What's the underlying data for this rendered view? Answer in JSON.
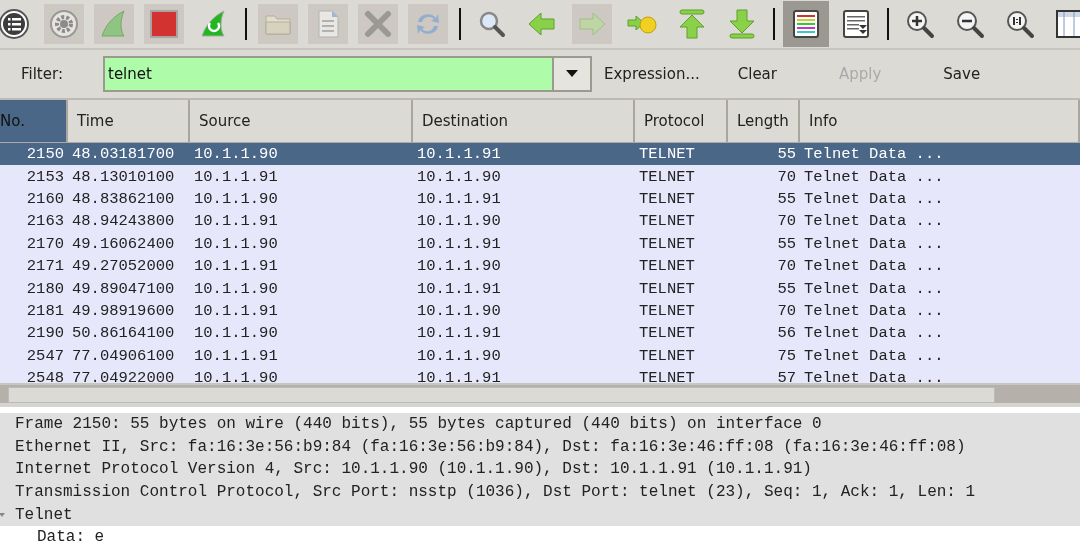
{
  "toolbar": [
    {
      "kind": "interfaces",
      "disabled": false
    },
    {
      "kind": "options",
      "disabled": true
    },
    {
      "kind": "start",
      "disabled": true
    },
    {
      "kind": "stop",
      "disabled": true
    },
    {
      "kind": "restart",
      "disabled": false
    },
    {
      "kind": "separator"
    },
    {
      "kind": "open",
      "disabled": true
    },
    {
      "kind": "file",
      "disabled": true
    },
    {
      "kind": "close",
      "disabled": true
    },
    {
      "kind": "reload",
      "disabled": true
    },
    {
      "kind": "separator"
    },
    {
      "kind": "find",
      "disabled": false
    },
    {
      "kind": "back",
      "disabled": false
    },
    {
      "kind": "forward",
      "disabled": true
    },
    {
      "kind": "goto",
      "disabled": false
    },
    {
      "kind": "first",
      "disabled": false
    },
    {
      "kind": "last",
      "disabled": false
    },
    {
      "kind": "separator"
    },
    {
      "kind": "colorize",
      "disabled": false,
      "pressed": true
    },
    {
      "kind": "autoscroll",
      "disabled": false,
      "pressed": false
    },
    {
      "kind": "separator"
    },
    {
      "kind": "zoom-in",
      "disabled": false
    },
    {
      "kind": "zoom-out",
      "disabled": false
    },
    {
      "kind": "zoom-normal",
      "disabled": false
    },
    {
      "kind": "resize",
      "disabled": false
    }
  ],
  "filter": {
    "label": "Filter:",
    "value": "telnet",
    "buttons": [
      {
        "label": "Expression...",
        "disabled": false
      },
      {
        "label": "Clear",
        "disabled": false
      },
      {
        "label": "Apply",
        "disabled": true
      },
      {
        "label": "Save",
        "disabled": false
      }
    ]
  },
  "table": {
    "columns": [
      {
        "label": "No.",
        "selected": true
      },
      {
        "label": "Time",
        "selected": false
      },
      {
        "label": "Source",
        "selected": false
      },
      {
        "label": "Destination",
        "selected": false
      },
      {
        "label": "Protocol",
        "selected": false
      },
      {
        "label": "Length",
        "selected": false
      },
      {
        "label": "Info",
        "selected": false
      }
    ],
    "rows": [
      {
        "cells": [
          "2150",
          "48.03181700",
          "10.1.1.90",
          "10.1.1.91",
          "TELNET",
          "55",
          "Telnet Data ..."
        ],
        "selected": true
      },
      {
        "cells": [
          "2153",
          "48.13010100",
          "10.1.1.91",
          "10.1.1.90",
          "TELNET",
          "70",
          "Telnet Data ..."
        ],
        "selected": false
      },
      {
        "cells": [
          "2160",
          "48.83862100",
          "10.1.1.90",
          "10.1.1.91",
          "TELNET",
          "55",
          "Telnet Data ..."
        ],
        "selected": false
      },
      {
        "cells": [
          "2163",
          "48.94243800",
          "10.1.1.91",
          "10.1.1.90",
          "TELNET",
          "70",
          "Telnet Data ..."
        ],
        "selected": false
      },
      {
        "cells": [
          "2170",
          "49.16062400",
          "10.1.1.90",
          "10.1.1.91",
          "TELNET",
          "55",
          "Telnet Data ..."
        ],
        "selected": false
      },
      {
        "cells": [
          "2171",
          "49.27052000",
          "10.1.1.91",
          "10.1.1.90",
          "TELNET",
          "70",
          "Telnet Data ..."
        ],
        "selected": false
      },
      {
        "cells": [
          "2180",
          "49.89047100",
          "10.1.1.90",
          "10.1.1.91",
          "TELNET",
          "55",
          "Telnet Data ..."
        ],
        "selected": false
      },
      {
        "cells": [
          "2181",
          "49.98919600",
          "10.1.1.91",
          "10.1.1.90",
          "TELNET",
          "70",
          "Telnet Data ..."
        ],
        "selected": false
      },
      {
        "cells": [
          "2190",
          "50.86164100",
          "10.1.1.90",
          "10.1.1.91",
          "TELNET",
          "56",
          "Telnet Data ..."
        ],
        "selected": false
      },
      {
        "cells": [
          "2547",
          "77.04906100",
          "10.1.1.91",
          "10.1.1.90",
          "TELNET",
          "75",
          "Telnet Data ..."
        ],
        "selected": false
      },
      {
        "cells": [
          "2548",
          "77.04922000",
          "10.1.1.90",
          "10.1.1.91",
          "TELNET",
          "57",
          "Telnet Data ..."
        ],
        "selected": false
      }
    ]
  },
  "details": [
    {
      "text": "Frame 2150: 55 bytes on wire (440 bits), 55 bytes captured (440 bits) on interface 0",
      "expanded": false
    },
    {
      "text": "Ethernet II, Src: fa:16:3e:56:b9:84 (fa:16:3e:56:b9:84), Dst: fa:16:3e:46:ff:08 (fa:16:3e:46:ff:08)",
      "expanded": false
    },
    {
      "text": "Internet Protocol Version 4, Src: 10.1.1.90 (10.1.1.90), Dst: 10.1.1.91 (10.1.1.91)",
      "expanded": false
    },
    {
      "text": "Transmission Control Protocol, Src Port: nsstp (1036), Dst Port: telnet (23), Seq: 1, Ack: 1, Len: 1",
      "expanded": false
    },
    {
      "text": "Telnet",
      "expanded": true,
      "children": [
        {
          "text": "Data: e"
        }
      ]
    }
  ]
}
